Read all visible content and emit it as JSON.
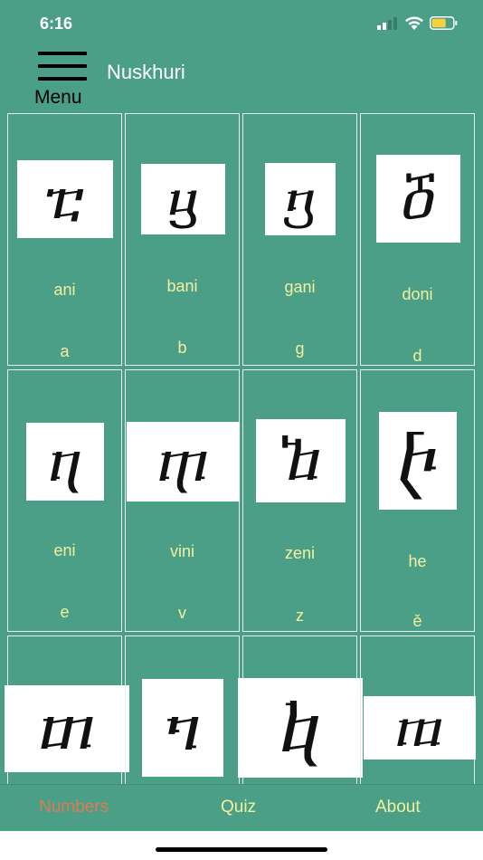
{
  "status": {
    "time": "6:16"
  },
  "header": {
    "menu_label": "Menu",
    "title": "Nuskhuri"
  },
  "letters": [
    {
      "glyph": "ⴀ",
      "name": "ani",
      "translit": "a"
    },
    {
      "glyph": "ⴁ",
      "name": "bani",
      "translit": "b"
    },
    {
      "glyph": "ⴂ",
      "name": "gani",
      "translit": "g"
    },
    {
      "glyph": "ⴃ",
      "name": "doni",
      "translit": "d"
    },
    {
      "glyph": "ⴄ",
      "name": "eni",
      "translit": "e"
    },
    {
      "glyph": "ⴅ",
      "name": "vini",
      "translit": "v"
    },
    {
      "glyph": "ⴆ",
      "name": "zeni",
      "translit": "z"
    },
    {
      "glyph": "ⴡ",
      "name": "he",
      "translit": "ě"
    },
    {
      "glyph": "ⴇ",
      "name": "",
      "translit": ""
    },
    {
      "glyph": "ⴈ",
      "name": "",
      "translit": ""
    },
    {
      "glyph": "ⴉ",
      "name": "",
      "translit": ""
    },
    {
      "glyph": "ⴊ",
      "name": "",
      "translit": ""
    }
  ],
  "tabs": [
    {
      "label": "Numbers",
      "color": "#e07a55"
    },
    {
      "label": "Quiz",
      "color": "#f3f0a0"
    },
    {
      "label": "About",
      "color": "#f3f0a0"
    }
  ],
  "colors": {
    "background": "#4a9f86",
    "letter_text": "#f3f0a0",
    "active_tab": "#e07a55"
  }
}
